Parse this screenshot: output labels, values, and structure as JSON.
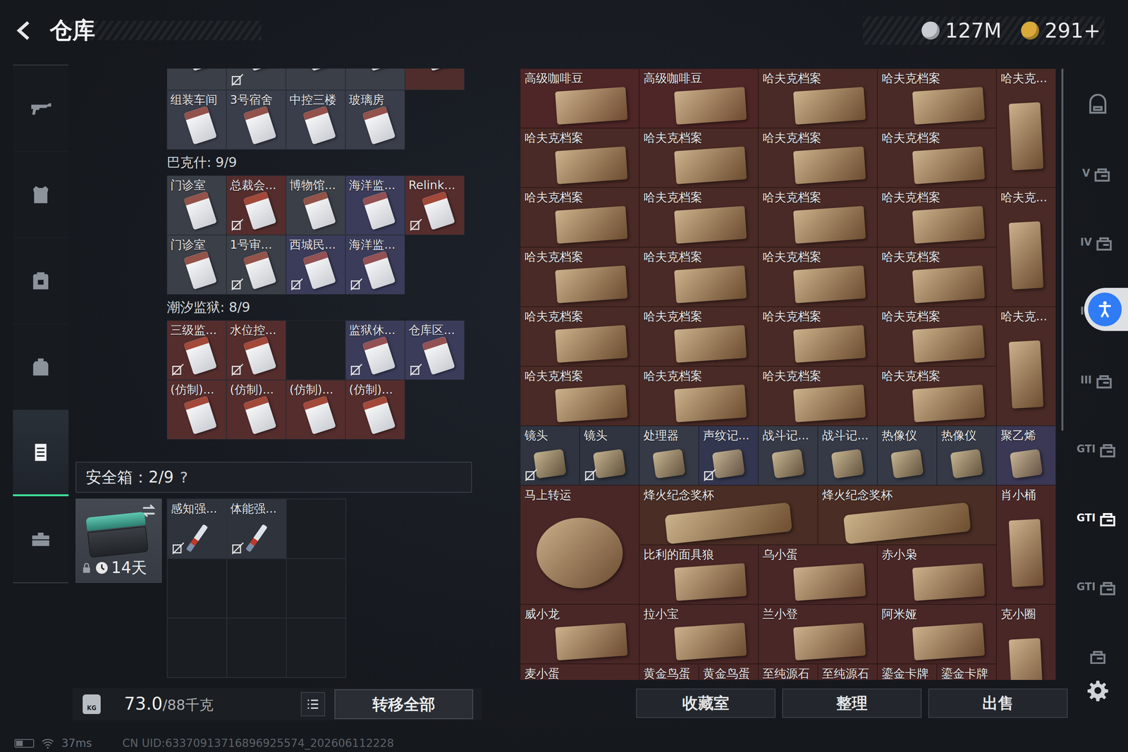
{
  "window": {
    "title": "仓库"
  },
  "currencies": [
    {
      "value": "127M",
      "color": "#c8ccd2"
    },
    {
      "value": "291+",
      "color": "#d9a93a"
    }
  ],
  "sidebar": {
    "items": [
      {
        "selected": false
      },
      {
        "selected": false
      },
      {
        "selected": false
      },
      {
        "selected": false
      },
      {
        "selected": true
      },
      {
        "selected": false
      }
    ]
  },
  "key_sections": [
    {
      "items": [
        {
          "label": "",
          "kind": "card",
          "color": "#3b3f48",
          "bound": false
        },
        {
          "label": "",
          "kind": "card",
          "color": "#3b3f48",
          "bound": true
        },
        {
          "label": "",
          "kind": "card",
          "color": "#3b3f48",
          "bound": false
        },
        {
          "label": "",
          "kind": "card",
          "color": "#3b3f48",
          "bound": false
        },
        {
          "label": "",
          "kind": "card",
          "color": "#4f2d2c",
          "bound": false
        },
        {
          "label": "组装车间",
          "kind": "card",
          "color": "#3a3e4b",
          "bound": false
        },
        {
          "label": "3号宿舍",
          "kind": "card",
          "color": "#3a3e4b",
          "bound": false
        },
        {
          "label": "中控三楼",
          "kind": "card",
          "color": "#3a3e4b",
          "bound": false
        },
        {
          "label": "玻璃房",
          "kind": "card",
          "color": "#3a3e4b",
          "bound": false
        }
      ]
    },
    {
      "title": "巴克什: 9/9",
      "items": [
        {
          "label": "门诊室",
          "kind": "card",
          "color": "#3b3f48",
          "bound": false
        },
        {
          "label": "总裁会...",
          "kind": "card",
          "color": "#552d2d",
          "bound": true
        },
        {
          "label": "博物馆...",
          "kind": "card",
          "color": "#3b3f48",
          "bound": false
        },
        {
          "label": "海洋监...",
          "kind": "card",
          "color": "#3b3c5a",
          "bound": false
        },
        {
          "label": "Relink...",
          "kind": "card",
          "color": "#552d2d",
          "bound": true
        },
        {
          "label": "门诊室",
          "kind": "card",
          "color": "#3b3f48",
          "bound": false
        },
        {
          "label": "1号审...",
          "kind": "card",
          "color": "#3b3f48",
          "bound": true
        },
        {
          "label": "西城民...",
          "kind": "card",
          "color": "#3b3c5a",
          "bound": true
        },
        {
          "label": "海洋监...",
          "kind": "card",
          "color": "#3b3c5a",
          "bound": true
        }
      ]
    },
    {
      "title": "潮汐监狱: 8/9",
      "items": [
        {
          "label": "三级监...",
          "kind": "card",
          "color": "#552d2d",
          "bound": true
        },
        {
          "label": "水位控...",
          "kind": "card",
          "color": "#552d2d",
          "bound": true
        },
        {
          "label": "",
          "kind": "empty",
          "color": "#1b1e23",
          "bound": false
        },
        {
          "label": "监狱休...",
          "kind": "card",
          "color": "#3b3c5a",
          "bound": true
        },
        {
          "label": "仓库区...",
          "kind": "card",
          "color": "#3b3c5a",
          "bound": true
        },
        {
          "label": "(仿制)...",
          "kind": "card",
          "color": "#552d2d",
          "bound": false
        },
        {
          "label": "(仿制)...",
          "kind": "card",
          "color": "#552d2d",
          "bound": false
        },
        {
          "label": "(仿制)...",
          "kind": "card",
          "color": "#552d2d",
          "bound": false
        },
        {
          "label": "(仿制)...",
          "kind": "card",
          "color": "#552d2d",
          "bound": false
        }
      ]
    }
  ],
  "safe": {
    "title": "安全箱：2/9",
    "help": "?",
    "timer": "14天",
    "slots": [
      {
        "label": "感知强...",
        "kind": "item",
        "bound": true
      },
      {
        "label": "体能强...",
        "kind": "item",
        "bound": true
      },
      {
        "label": "",
        "kind": "empty",
        "bound": false
      },
      {
        "label": "",
        "kind": "empty",
        "bound": false
      },
      {
        "label": "",
        "kind": "empty",
        "bound": false
      },
      {
        "label": "",
        "kind": "empty",
        "bound": false
      },
      {
        "label": "",
        "kind": "empty",
        "bound": false
      },
      {
        "label": "",
        "kind": "empty",
        "bound": false
      },
      {
        "label": "",
        "kind": "empty",
        "bound": false
      }
    ]
  },
  "weight": {
    "icon_text": "KG",
    "current": "73.0",
    "capacity": "/88千克"
  },
  "transfer_button": "转移全部",
  "stash_items": [
    {
      "label": "高级咖啡豆",
      "kind": "wide",
      "color": "#4e2627",
      "bound": false
    },
    {
      "label": "高级咖啡豆",
      "kind": "wide",
      "color": "#4e2627",
      "bound": false
    },
    {
      "label": "哈夫克档案",
      "kind": "wide",
      "color": "#4a2a26",
      "bound": false
    },
    {
      "label": "哈夫克档案",
      "kind": "wide",
      "color": "#4a2a26",
      "bound": false
    },
    {
      "label": "哈夫克...",
      "kind": "tall",
      "color": "#4a2a26",
      "bound": false
    },
    {
      "label": "哈夫克档案",
      "kind": "wide",
      "color": "#4a2a26",
      "bound": false
    },
    {
      "label": "哈夫克档案",
      "kind": "wide",
      "color": "#4a2a26",
      "bound": false
    },
    {
      "label": "哈夫克档案",
      "kind": "wide",
      "color": "#4a2a26",
      "bound": false
    },
    {
      "label": "哈夫克档案",
      "kind": "wide",
      "color": "#4a2a26",
      "bound": false
    },
    {
      "label": "哈夫克档案",
      "kind": "wide",
      "color": "#4a2a26",
      "bound": false
    },
    {
      "label": "哈夫克档案",
      "kind": "wide",
      "color": "#4a2a26",
      "bound": false
    },
    {
      "label": "哈夫克档案",
      "kind": "wide",
      "color": "#4a2a26",
      "bound": false
    },
    {
      "label": "哈夫克档案",
      "kind": "wide",
      "color": "#4a2a26",
      "bound": false
    },
    {
      "label": "哈夫克...",
      "kind": "tall",
      "color": "#4a2a26",
      "bound": false
    },
    {
      "label": "哈夫克档案",
      "kind": "wide",
      "color": "#4a2a26",
      "bound": false
    },
    {
      "label": "哈夫克档案",
      "kind": "wide",
      "color": "#4a2a26",
      "bound": false
    },
    {
      "label": "哈夫克档案",
      "kind": "wide",
      "color": "#4a2a26",
      "bound": false
    },
    {
      "label": "哈夫克档案",
      "kind": "wide",
      "color": "#4a2a26",
      "bound": false
    },
    {
      "label": "哈夫克档案",
      "kind": "wide",
      "color": "#4a2a26",
      "bound": false
    },
    {
      "label": "哈夫克档案",
      "kind": "wide",
      "color": "#4a2a26",
      "bound": false
    },
    {
      "label": "哈夫克档案",
      "kind": "wide",
      "color": "#4a2a26",
      "bound": false
    },
    {
      "label": "哈夫克档案",
      "kind": "wide",
      "color": "#4a2a26",
      "bound": false
    },
    {
      "label": "哈夫克...",
      "kind": "tall",
      "color": "#4a2a26",
      "bound": false
    },
    {
      "label": "哈夫克档案",
      "kind": "wide",
      "color": "#4a2a26",
      "bound": false
    },
    {
      "label": "哈夫克档案",
      "kind": "wide",
      "color": "#4a2a26",
      "bound": false
    },
    {
      "label": "哈夫克档案",
      "kind": "wide",
      "color": "#4a2a26",
      "bound": false
    },
    {
      "label": "哈夫克档案",
      "kind": "wide",
      "color": "#4a2a26",
      "bound": false
    },
    {
      "label": "镜头",
      "kind": "small",
      "color": "#2f3440",
      "bound": true
    },
    {
      "label": "镜头",
      "kind": "small",
      "color": "#2f3440",
      "bound": true
    },
    {
      "label": "处理器",
      "kind": "small",
      "color": "#363a46",
      "bound": false
    },
    {
      "label": "声纹记...",
      "kind": "small",
      "color": "#33364f",
      "bound": true
    },
    {
      "label": "战斗记...",
      "kind": "small",
      "color": "#363a46",
      "bound": false
    },
    {
      "label": "战斗记...",
      "kind": "small",
      "color": "#363a46",
      "bound": false
    },
    {
      "label": "热像仪",
      "kind": "small",
      "color": "#363a46",
      "bound": false
    },
    {
      "label": "热像仪",
      "kind": "small",
      "color": "#363a46",
      "bound": false
    },
    {
      "label": "聚乙烯",
      "kind": "small",
      "color": "#3a3854",
      "bound": false
    },
    {
      "label": "马上转运",
      "kind": "large",
      "color": "#4a2727",
      "bound": false
    },
    {
      "label": "烽火纪念奖杯",
      "kind": "long",
      "color": "#4a2d24",
      "bound": false
    },
    {
      "label": "烽火纪念奖杯",
      "kind": "long",
      "color": "#4a2d24",
      "bound": false
    },
    {
      "label": "肖小桶",
      "kind": "tall",
      "color": "#4a2727",
      "bound": false
    },
    {
      "label": "比利的面具狼",
      "kind": "wide",
      "color": "#4a2727",
      "bound": false
    },
    {
      "label": "乌小蛋",
      "kind": "wide",
      "color": "#4a2727",
      "bound": false
    },
    {
      "label": "赤小枭",
      "kind": "wide",
      "color": "#4a2727",
      "bound": false
    },
    {
      "label": "威小龙",
      "kind": "wide",
      "color": "#4a2727",
      "bound": false
    },
    {
      "label": "拉小宝",
      "kind": "wide",
      "color": "#4a2727",
      "bound": false
    },
    {
      "label": "兰小登",
      "kind": "wide",
      "color": "#4a2727",
      "bound": false
    },
    {
      "label": "阿米娅",
      "kind": "wide",
      "color": "#4a2727",
      "bound": false
    },
    {
      "label": "克小圈",
      "kind": "tall",
      "color": "#4a2727",
      "bound": false
    },
    {
      "label": "麦小蛋",
      "kind": "wide",
      "color": "#4a2727",
      "bound": false
    },
    {
      "label": "黄金鸟蛋",
      "kind": "small",
      "color": "#4a2727",
      "bound": false
    },
    {
      "label": "黄金鸟蛋",
      "kind": "small",
      "color": "#4a2727",
      "bound": false
    },
    {
      "label": "至纯源石",
      "kind": "small",
      "color": "#4a2727",
      "bound": false
    },
    {
      "label": "至纯源石",
      "kind": "small",
      "color": "#4a2727",
      "bound": false
    },
    {
      "label": "鎏金卡牌",
      "kind": "small",
      "color": "#4a2727",
      "bound": false
    },
    {
      "label": "鎏金卡牌",
      "kind": "small",
      "color": "#4a2727",
      "bound": false
    }
  ],
  "stash_buttons": [
    "收藏室",
    "整理",
    "出售"
  ],
  "right_rail": {
    "items": [
      {
        "mark": "",
        "selected": false
      },
      {
        "mark": "V",
        "selected": false
      },
      {
        "mark": "IV",
        "selected": false
      },
      {
        "mark": "IV",
        "selected": false
      },
      {
        "mark": "III",
        "selected": false
      },
      {
        "mark": "GTI",
        "selected": false
      },
      {
        "mark": "GTI",
        "selected": true
      },
      {
        "mark": "GTI",
        "selected": false
      },
      {
        "mark": "",
        "selected": false
      }
    ]
  },
  "status_bar": {
    "latency": "37ms",
    "uid": "CN UID:63370913716896925574_202606112228"
  }
}
